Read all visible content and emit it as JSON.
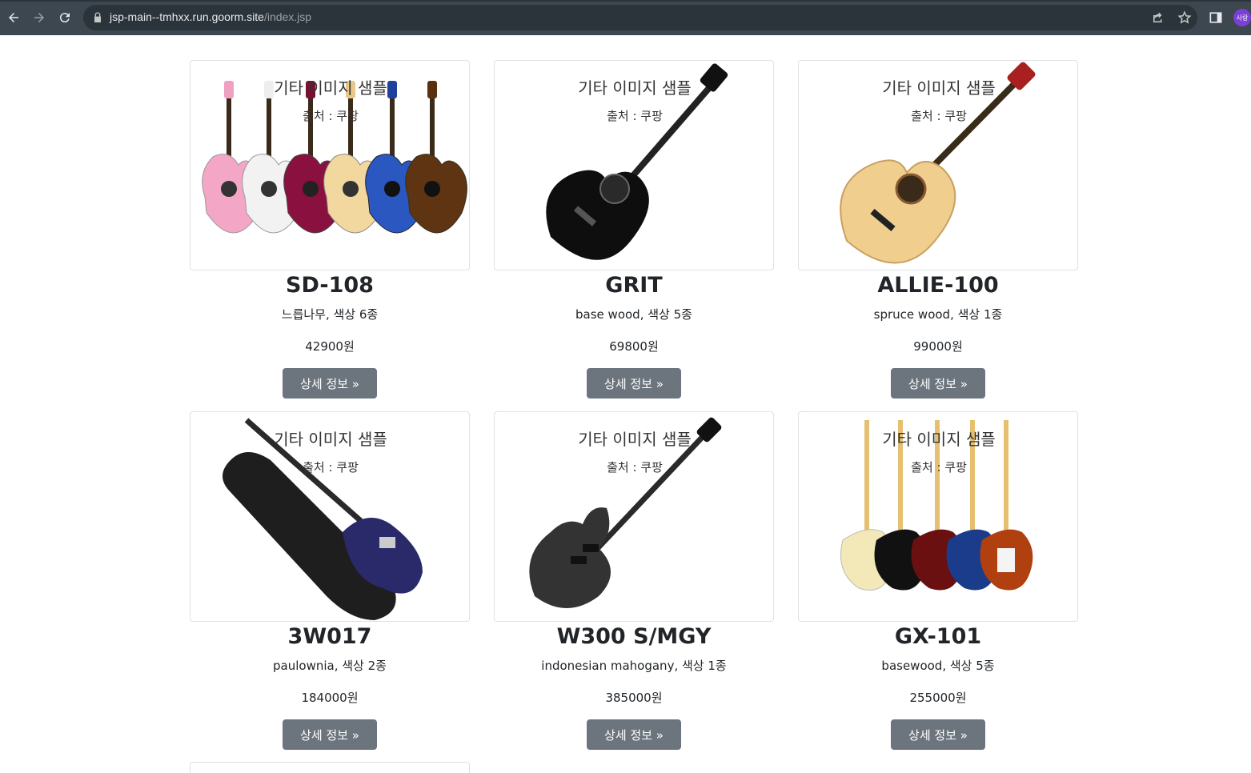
{
  "browser": {
    "url_host": "jsp-main--tmhxx.run.goorm.site",
    "url_path": "/index.jsp",
    "profile": "사랑"
  },
  "caption": {
    "title": "기타 이미지 샘플",
    "source": "출처 : 쿠팡"
  },
  "products": [
    {
      "name": "SD-108",
      "desc": "느릅나무, 색상 6종",
      "price": "42900원",
      "button": "상세 정보 »"
    },
    {
      "name": "GRIT",
      "desc": "base wood, 색상 5종",
      "price": "69800원",
      "button": "상세 정보 »"
    },
    {
      "name": "ALLIE-100",
      "desc": "spruce wood, 색상 1종",
      "price": "99000원",
      "button": "상세 정보 »"
    },
    {
      "name": "3W017",
      "desc": "paulownia, 색상 2종",
      "price": "184000원",
      "button": "상세 정보 »"
    },
    {
      "name": "W300 S/MGY",
      "desc": "indonesian mahogany, 색상 1종",
      "price": "385000원",
      "button": "상세 정보 »"
    },
    {
      "name": "GX-101",
      "desc": "basewood, 색상 5종",
      "price": "255000원",
      "button": "상세 정보 »"
    }
  ],
  "colors": {
    "chrome_bg": "#3c4750",
    "button_bg": "#6c757d",
    "border": "#dee2e6"
  }
}
